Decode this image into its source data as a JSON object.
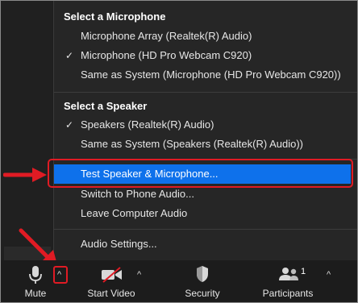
{
  "menu": {
    "microphone_header": "Select a Microphone",
    "microphones": [
      {
        "label": "Microphone Array (Realtek(R) Audio)",
        "checked": false
      },
      {
        "label": "Microphone (HD Pro Webcam C920)",
        "checked": true
      },
      {
        "label": "Same as System (Microphone (HD Pro Webcam C920))",
        "checked": false
      }
    ],
    "speaker_header": "Select a Speaker",
    "speakers": [
      {
        "label": "Speakers (Realtek(R) Audio)",
        "checked": true
      },
      {
        "label": "Same as System (Speakers (Realtek(R) Audio))",
        "checked": false
      }
    ],
    "test_label": "Test Speaker & Microphone...",
    "phone_label": "Switch to Phone Audio...",
    "leave_label": "Leave Computer Audio",
    "settings_label": "Audio Settings...",
    "check_glyph": "✓"
  },
  "toolbar": {
    "mute_label": "Mute",
    "start_video_label": "Start Video",
    "security_label": "Security",
    "participants_label": "Participants",
    "participants_count": "1",
    "caret_glyph": "^"
  },
  "colors": {
    "highlight": "#0e71eb",
    "annotation_red": "#e01b24",
    "menu_bg": "#262626"
  }
}
